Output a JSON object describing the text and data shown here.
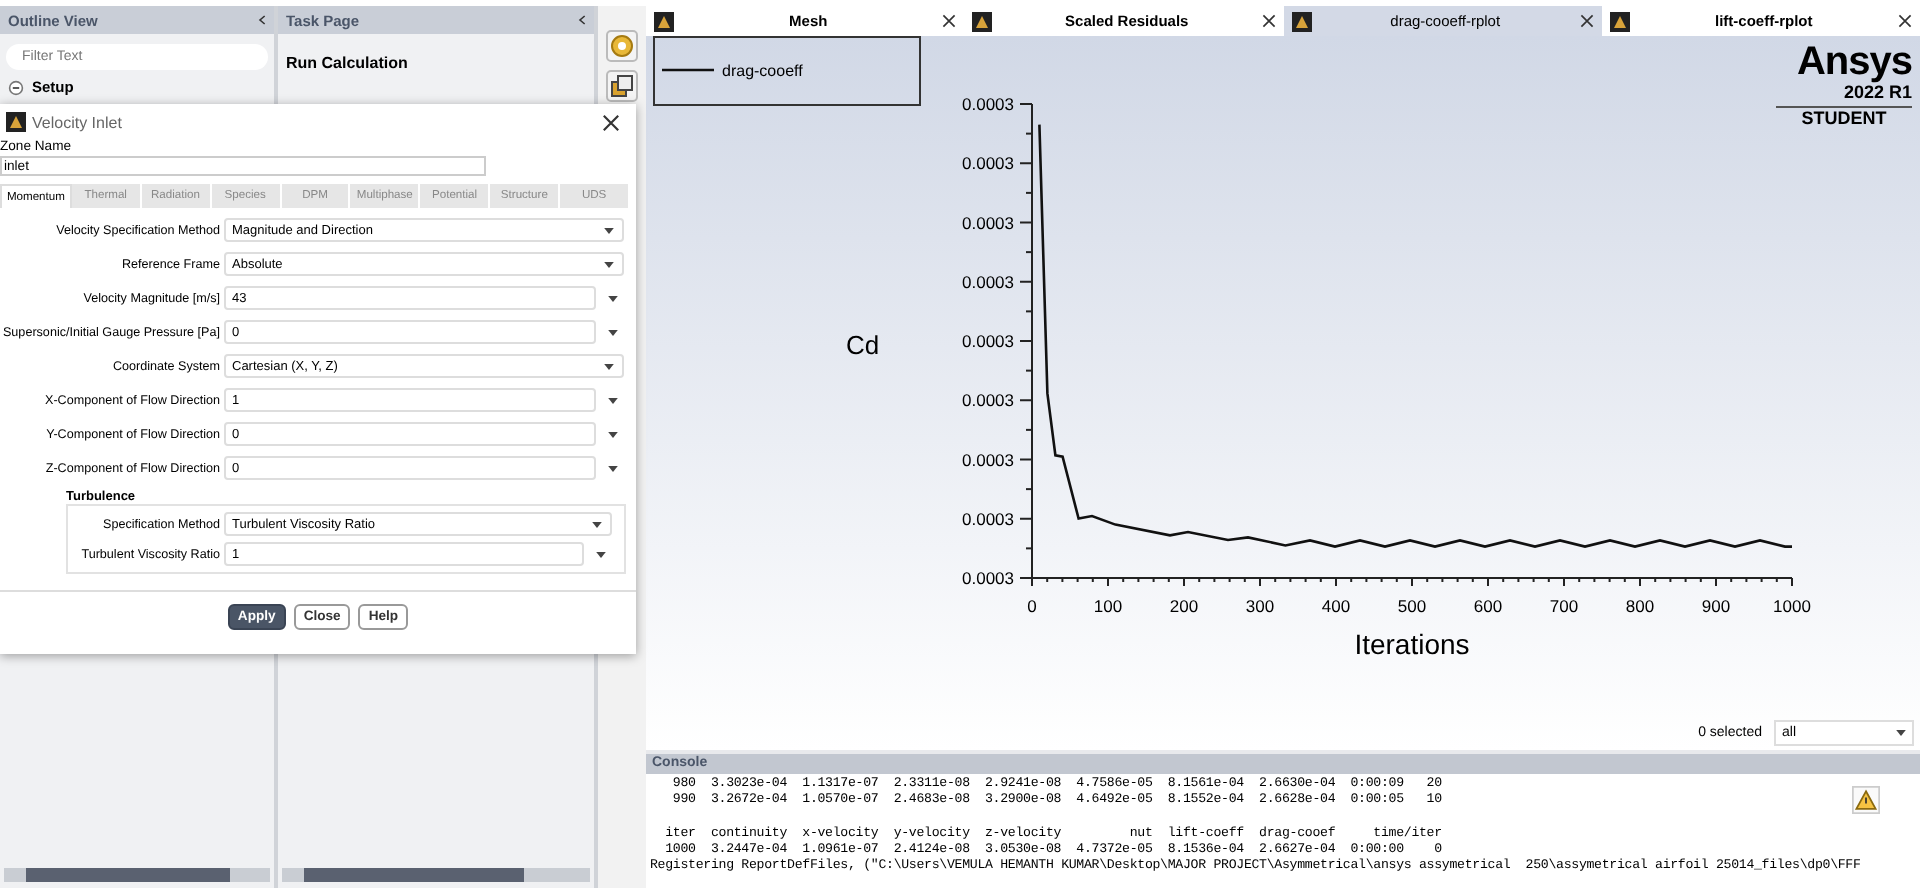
{
  "outline_view": {
    "title": "Outline View",
    "filter": {
      "placeholder": "Filter Text"
    },
    "tree": [
      {
        "label": "Setup",
        "expanded": true
      }
    ]
  },
  "task_page": {
    "title": "Task Page",
    "heading": "Run Calculation"
  },
  "graphics_tabs": [
    {
      "label": "Mesh",
      "selected": false
    },
    {
      "label": "Scaled Residuals",
      "selected": false
    },
    {
      "label": "drag-cooeff-rplot",
      "selected": true
    },
    {
      "label": "lift-coeff-rplot",
      "selected": false
    }
  ],
  "plot": {
    "legend": "drag-cooeff",
    "ylabel": "Cd",
    "xlabel": "Iterations",
    "yticks": [
      "0.0003",
      "0.0003",
      "0.0003",
      "0.0003",
      "0.0003",
      "0.0003",
      "0.0003",
      "0.0003",
      "0.0003"
    ],
    "xticks": [
      "0",
      "100",
      "200",
      "300",
      "400",
      "500",
      "600",
      "700",
      "800",
      "900",
      "1000"
    ]
  },
  "logo": {
    "name": "Ansys",
    "version": "2022 R1",
    "edition": "STUDENT"
  },
  "selection": {
    "count": "0 selected",
    "filter": "all"
  },
  "console": {
    "title": "Console",
    "lines": [
      "   980  3.3023e-04  1.1317e-07  2.3311e-08  2.9241e-08  4.7586e-05  8.1561e-04  2.6630e-04  0:00:09   20",
      "   990  3.2672e-04  1.0570e-07  2.4683e-08  3.2900e-08  4.6492e-05  8.1552e-04  2.6628e-04  0:00:05   10",
      "  iter  continuity  x-velocity  y-velocity  z-velocity         nut  lift-coeff  drag-cooef     time/iter",
      "  1000  3.2447e-04  1.0961e-07  2.4124e-08  3.0530e-08  4.7372e-05  8.1536e-04  2.6627e-04  0:00:00    0",
      "Registering ReportDefFiles, (\"C:\\Users\\VEMULA HEMANTH KUMAR\\Desktop\\MAJOR PROJECT\\Asymmetrical\\ansys assymetrical  250\\assymetrical airfoil 25014_files\\dp0\\FFF"
    ]
  },
  "dialog": {
    "title": "Velocity Inlet",
    "zone_label": "Zone Name",
    "zone_value": "inlet",
    "tabs": [
      {
        "label": "Momentum",
        "selected": true
      },
      {
        "label": "Thermal",
        "selected": false
      },
      {
        "label": "Radiation",
        "selected": false
      },
      {
        "label": "Species",
        "selected": false
      },
      {
        "label": "DPM",
        "selected": false
      },
      {
        "label": "Multiphase",
        "selected": false
      },
      {
        "label": "Potential",
        "selected": false
      },
      {
        "label": "Structure",
        "selected": false
      },
      {
        "label": "UDS",
        "selected": false
      }
    ],
    "fields": [
      {
        "kind": "select",
        "label": "Velocity Specification Method",
        "value": "Magnitude and Direction"
      },
      {
        "kind": "select",
        "label": "Reference Frame",
        "value": "Absolute"
      },
      {
        "kind": "input",
        "label": "Velocity Magnitude [m/s]",
        "value": "43"
      },
      {
        "kind": "input",
        "label": "Supersonic/Initial Gauge Pressure [Pa]",
        "value": "0"
      },
      {
        "kind": "select",
        "label": "Coordinate System",
        "value": "Cartesian (X, Y, Z)"
      },
      {
        "kind": "input",
        "label": "X-Component of Flow Direction",
        "value": "1"
      },
      {
        "kind": "input",
        "label": "Y-Component of Flow Direction",
        "value": "0"
      },
      {
        "kind": "input",
        "label": "Z-Component of Flow Direction",
        "value": "0"
      }
    ],
    "turbulence": {
      "title": "Turbulence",
      "fields": [
        {
          "kind": "select",
          "label": "Specification Method",
          "value": "Turbulent Viscosity Ratio"
        },
        {
          "kind": "input",
          "label": "Turbulent Viscosity Ratio",
          "value": "1"
        }
      ]
    },
    "buttons": [
      {
        "label": "Apply",
        "primary": true
      },
      {
        "label": "Close",
        "primary": false
      },
      {
        "label": "Help",
        "primary": false
      }
    ]
  }
}
